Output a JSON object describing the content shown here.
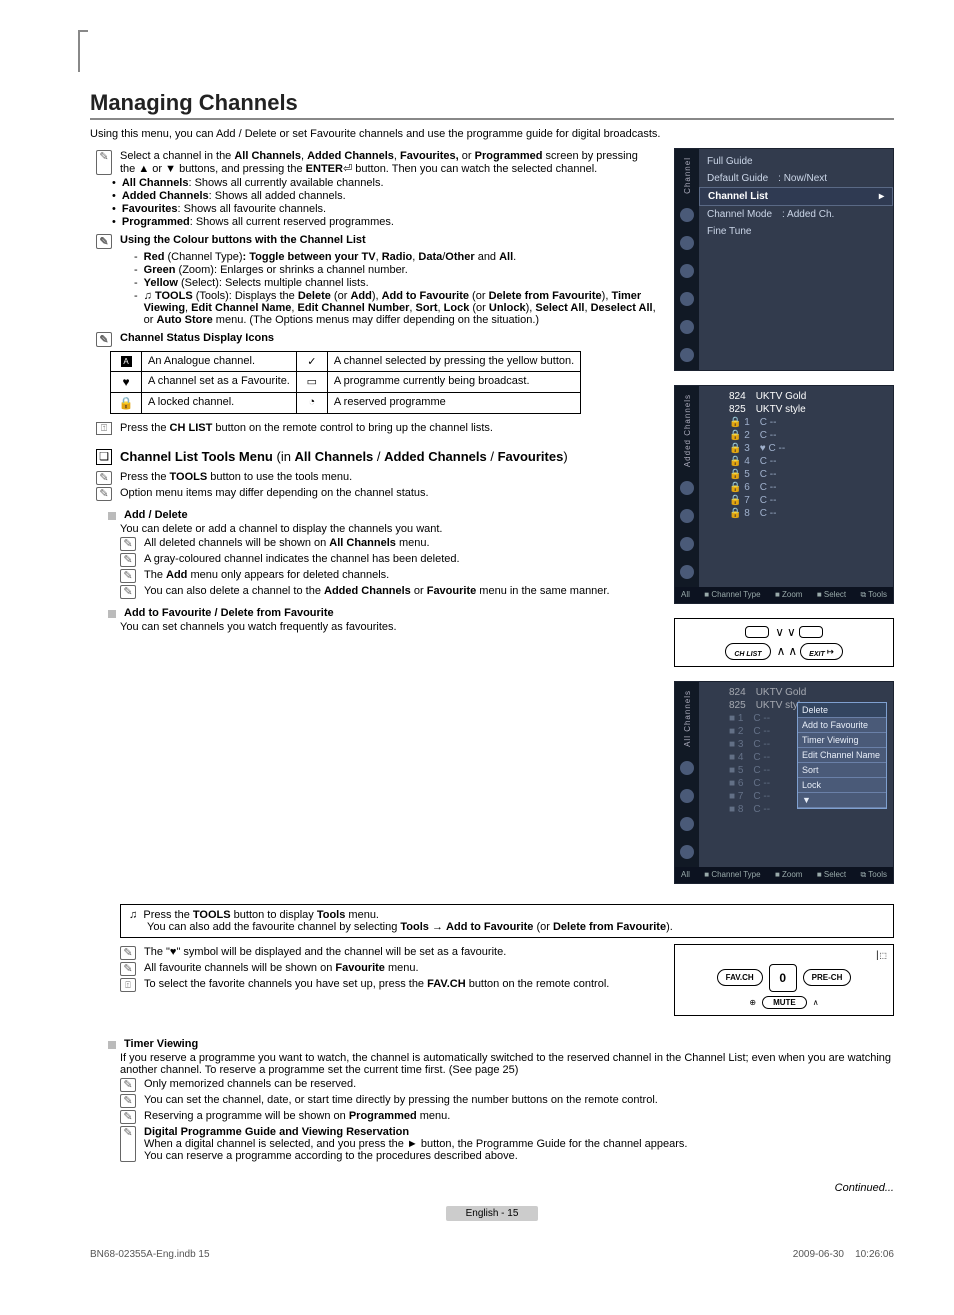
{
  "page": {
    "title": "Managing Channels",
    "intro": "Using this menu, you can Add / Delete or set Favourite channels and use the programme guide for digital broadcasts.",
    "continued": "Continued...",
    "footer": "English - 15",
    "meta_left": "BN68-02355A-Eng.indb   15",
    "meta_right": "2009-06-30      10:26:06"
  },
  "notes": {
    "n1_a": "Select a channel in the ",
    "n1_b": "All Channels",
    "n1_c": ", ",
    "n1_d": "Added Channels",
    "n1_e": ", ",
    "n1_f": "Favourites,",
    "n1_g": " or ",
    "n1_h": "Programmed",
    "n1_i": " screen by pressing the ▲ or ▼ buttons, and pressing the ",
    "n1_j": "ENTER",
    "n1_k": " button. Then you can watch the selected channel.",
    "all_channels_b": "All Channels",
    "all_channels_t": ": Shows all currently available channels.",
    "added_b": "Added Channels",
    "added_t": ": Shows all added channels.",
    "fav_b": "Favourites",
    "fav_t": ": Shows all favourite channels.",
    "prog_b": "Programmed",
    "prog_t": ": Shows all current reserved programmes.",
    "colour_head": "Using the Colour buttons with the Channel List",
    "red_b": "Red",
    "red_t1": " (Channel Type)",
    "red_t2": ": Toggle between your ",
    "red_tv": "TV",
    "red_c1": ", ",
    "red_radio": "Radio",
    "red_c2": ", ",
    "red_data": "Data",
    "red_sl": "/",
    "red_other": "Other",
    "red_and": " and ",
    "red_all": "All",
    "red_end": ".",
    "green_b": "Green",
    "green_t": " (Zoom): Enlarges or shrinks a channel number.",
    "yellow_b": "Yellow",
    "yellow_t": " (Select): Selects multiple channel lists.",
    "tools_b": "TOOLS",
    "tools_t1": " (Tools): Displays the ",
    "tools_del": "Delete",
    "tools_or1": " (or ",
    "tools_add": "Add",
    "tools_p1": "), ",
    "tools_atf": "Add to Favourite",
    "tools_or2": " (or ",
    "tools_dff": "Delete from Favourite",
    "tools_p2": "), ",
    "tools_tv": "Timer Viewing",
    "tools_c1": ", ",
    "tools_ecn": "Edit Channel Name",
    "tools_c2": ", ",
    "tools_ecnum": "Edit Channel Number",
    "tools_c3": ", ",
    "tools_sort": "Sort",
    "tools_c4": ", ",
    "tools_lock": "Lock",
    "tools_or3": " (or ",
    "tools_unlock": "Unlock",
    "tools_p3": "), ",
    "tools_sa": "Select All",
    "tools_c5": ", ",
    "tools_da": "Deselect All",
    "tools_or4": ", or ",
    "tools_as": "Auto Store",
    "tools_end": " menu. (The Options menus may differ depending on the situation.)",
    "status_head": "Channel Status Display Icons",
    "chlist_a": "Press the ",
    "chlist_b": "CH LIST",
    "chlist_c": " button on the remote control to bring up the channel lists."
  },
  "status_table": {
    "r1c1": "An Analogue channel.",
    "r1c2": "A channel selected by pressing the yellow button.",
    "r2c1": "A channel set as a Favourite.",
    "r2c2": "A programme currently being broadcast.",
    "r3c1": "A locked channel.",
    "r3c2": "A reserved programme"
  },
  "tools_menu": {
    "heading_a": "Channel List Tools Menu",
    "heading_b": " (in ",
    "heading_c": "All Channels",
    "heading_d": " / ",
    "heading_e": "Added Channels",
    "heading_f": " / ",
    "heading_g": "Favourites",
    "heading_h": ")",
    "n1_a": "Press the ",
    "n1_b": "TOOLS",
    "n1_c": " button to use the tools menu.",
    "n2": "Option menu items may differ depending on the channel status."
  },
  "add_delete": {
    "head_a": "Add",
    "head_b": " / ",
    "head_c": "Delete",
    "desc": "You can delete or add a channel to display the channels you want.",
    "n1_a": "All deleted channels will be shown on ",
    "n1_b": "All Channels",
    "n1_c": " menu.",
    "n2": "A gray-coloured channel indicates the channel has been deleted.",
    "n3_a": "The ",
    "n3_b": "Add",
    "n3_c": " menu only appears for deleted channels.",
    "n4_a": "You can also delete a channel to the ",
    "n4_b": "Added Channels",
    "n4_c": " or ",
    "n4_d": "Favourite",
    "n4_e": " menu in the same manner."
  },
  "fav_section": {
    "head_a": "Add to Favourite",
    "head_b": " / ",
    "head_c": "Delete from Favourite",
    "desc": "You can set channels you watch frequently as favourites.",
    "tip_a": "Press the ",
    "tip_b": "TOOLS",
    "tip_c": " button to display ",
    "tip_d": "Tools",
    "tip_e": " menu.",
    "tip2_a": "You can also add the favourite channel by selecting ",
    "tip2_b": "Tools",
    "tip2_ar": " → ",
    "tip2_c": "Add to Favourite",
    "tip2_d": " (or ",
    "tip2_e": "Delete from Favourite",
    "tip2_f": ").",
    "n1": "The \"♥\" symbol will be displayed and the channel will be set as a favourite.",
    "n2_a": "All favourite channels will be shown on ",
    "n2_b": "Favourite",
    "n2_c": " menu.",
    "n3_a": "To select the favorite channels you have set up, press the ",
    "n3_b": "FAV.CH",
    "n3_c": " button on the remote control."
  },
  "timer": {
    "head": "Timer Viewing",
    "desc": "If you reserve a programme you want to watch, the channel is automatically switched to the reserved channel in the Channel List; even when you are watching another channel. To reserve a programme set the current time first. (See page 25)",
    "n1": "Only memorized channels can be reserved.",
    "n2": "You can set the channel, date, or start time directly by pressing the number buttons on the remote control.",
    "n3_a": "Reserving a programme will be shown on ",
    "n3_b": "Programmed",
    "n3_c": " menu.",
    "n4_head": "Digital Programme Guide and Viewing Reservation",
    "n4_a": "When a digital channel is selected, and you press the ► button, the Programme Guide for the channel appears.",
    "n4_b": "You can reserve a programme  according to the procedures described above."
  },
  "osd1": {
    "side": "Channel",
    "r1": "Full Guide",
    "r2a": "Default Guide",
    "r2b": ": Now/Next",
    "r3": "Channel List",
    "r4a": "Channel Mode",
    "r4b": ": Added Ch.",
    "r5": "Fine Tune"
  },
  "osd2": {
    "side": "Added Channels",
    "top1_num": "824",
    "top1_name": "UKTV Gold",
    "top2_num": "825",
    "top2_name": "UKTV style",
    "rows": [
      {
        "i": "1",
        "c": "C --"
      },
      {
        "i": "2",
        "c": "C --"
      },
      {
        "i": "3",
        "c": "♥ C --"
      },
      {
        "i": "4",
        "c": "C --"
      },
      {
        "i": "5",
        "c": "C --"
      },
      {
        "i": "6",
        "c": "C --"
      },
      {
        "i": "7",
        "c": "C --"
      },
      {
        "i": "8",
        "c": "C --"
      }
    ],
    "footer_all": "All",
    "footer_ct": "Channel Type",
    "footer_zoom": "Zoom",
    "footer_sel": "Select",
    "footer_tools": "Tools"
  },
  "osd3": {
    "side": "All Channels",
    "top1_num": "824",
    "top1_name": "UKTV Gold",
    "top2_num": "825",
    "top2_name": "UKTV style",
    "rows": [
      {
        "i": "1",
        "c": "C --"
      },
      {
        "i": "2",
        "c": "C --"
      },
      {
        "i": "3",
        "c": "C --"
      },
      {
        "i": "4",
        "c": "C --"
      },
      {
        "i": "5",
        "c": "C --"
      },
      {
        "i": "6",
        "c": "C --"
      },
      {
        "i": "7",
        "c": "C --"
      },
      {
        "i": "8",
        "c": "C --"
      }
    ],
    "popup": [
      "Delete",
      "Add to Favourite",
      "Timer Viewing",
      "Edit Channel Name",
      "Sort",
      "Lock",
      "▼"
    ],
    "footer_all": "All",
    "footer_ct": "Channel Type",
    "footer_zoom": "Zoom",
    "footer_sel": "Select",
    "footer_tools": "Tools"
  },
  "remote1": {
    "chlist": "CH LIST",
    "exit": "EXIT"
  },
  "remote2": {
    "fav": "FAV.CH",
    "zero": "0",
    "prech": "PRE-CH",
    "mute": "MUTE"
  }
}
